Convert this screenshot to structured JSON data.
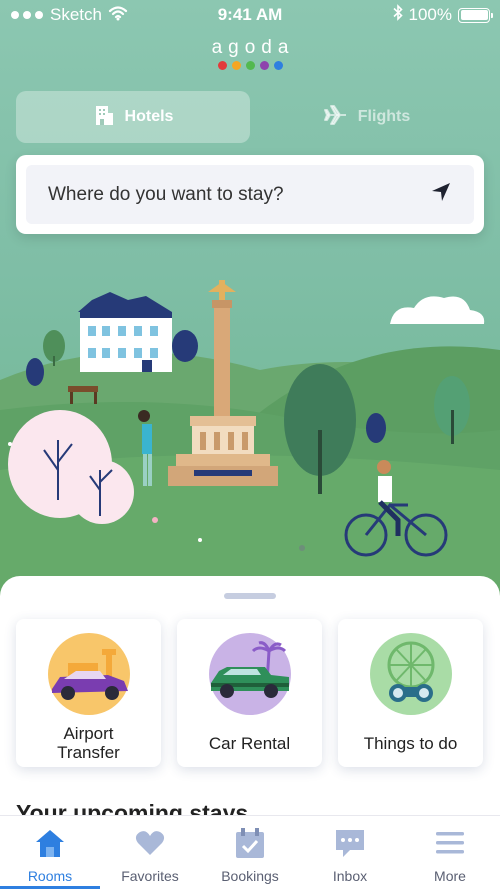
{
  "status_bar": {
    "carrier": "Sketch",
    "time": "9:41 AM",
    "battery": "100%"
  },
  "logo": {
    "text": "agoda",
    "dot_colors": [
      "#e23b3b",
      "#f5a623",
      "#53b94f",
      "#8e44ad",
      "#2e7fe0"
    ]
  },
  "tabs": [
    {
      "label": "Hotels",
      "icon": "hotel-icon",
      "active": true
    },
    {
      "label": "Flights",
      "icon": "airplane-icon",
      "active": false
    }
  ],
  "search": {
    "placeholder": "Where do you want to stay?",
    "icon": "location-arrow-icon"
  },
  "services": [
    {
      "label": "Airport\nTransfer",
      "icon": "airport-transfer-icon"
    },
    {
      "label": "Car Rental",
      "icon": "car-rental-icon"
    },
    {
      "label": "Things to do",
      "icon": "things-to-do-icon"
    }
  ],
  "upcoming": {
    "title": "Your upcoming stays"
  },
  "nav": [
    {
      "label": "Rooms",
      "icon": "house-icon",
      "active": true
    },
    {
      "label": "Favorites",
      "icon": "heart-icon",
      "active": false
    },
    {
      "label": "Bookings",
      "icon": "calendar-check-icon",
      "active": false
    },
    {
      "label": "Inbox",
      "icon": "chat-bubble-icon",
      "active": false
    },
    {
      "label": "More",
      "icon": "menu-icon",
      "active": false
    }
  ],
  "colors": {
    "accent": "#2e7fe0",
    "hero_green": "#7fbea6",
    "nav_icon": "#a9b8d8"
  }
}
